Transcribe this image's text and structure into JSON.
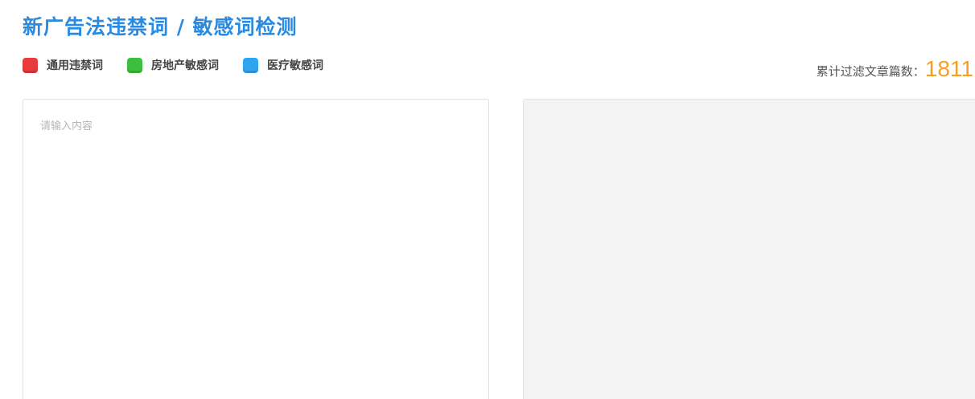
{
  "page": {
    "title": "新广告法违禁词 / 敏感词检测"
  },
  "legend": {
    "items": [
      {
        "label": "通用违禁词",
        "color": "#e83c3c",
        "name": "legend-item-general"
      },
      {
        "label": "房地产敏感词",
        "color": "#3cbf3c",
        "name": "legend-item-real-estate"
      },
      {
        "label": "医疗敏感词",
        "color": "#2fa4f0",
        "name": "legend-item-medical"
      }
    ]
  },
  "counter": {
    "label": "累计过滤文章篇数：",
    "value": "1811",
    "value_color": "#f5a020"
  },
  "input": {
    "placeholder": "请输入内容",
    "value": ""
  },
  "colors": {
    "title": "#2a8ae0",
    "result_background": "#f3f3f3"
  }
}
